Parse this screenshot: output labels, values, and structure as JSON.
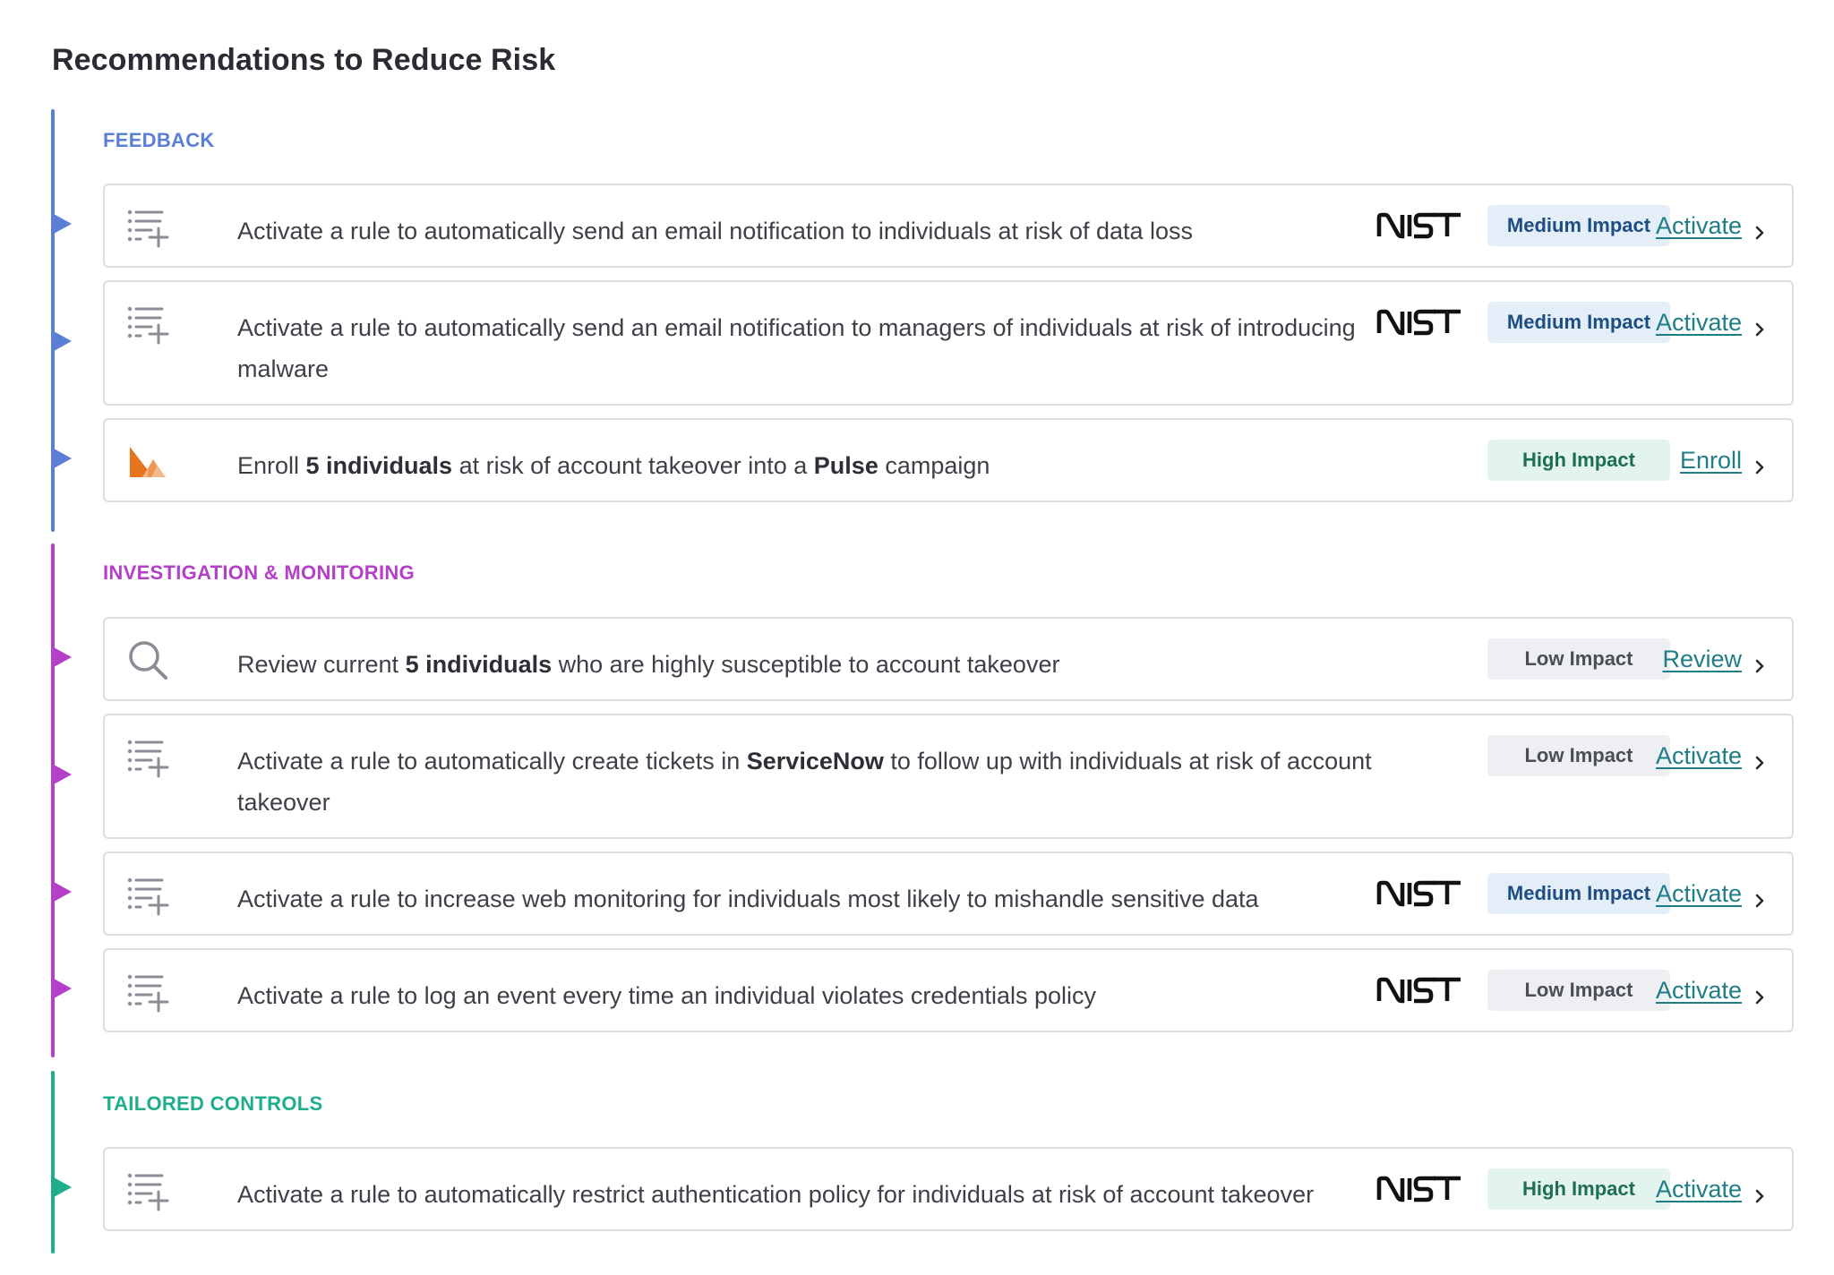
{
  "page": {
    "title": "Recommendations to Reduce Risk"
  },
  "colors": {
    "feedback": "#5b7fd6",
    "investigation": "#b53fc9",
    "tailored": "#1fae8c",
    "link": "#1e7d86"
  },
  "sections": [
    {
      "heading": "FEEDBACK",
      "color": "#5b7fd6",
      "items": [
        {
          "icon": "rule-list-add-icon",
          "text": [
            "Activate a rule to automatically send an email notification to individuals at risk of data loss"
          ],
          "nist": true,
          "nist_label": "NIST",
          "impact": "Medium Impact",
          "action": "Activate"
        },
        {
          "icon": "rule-list-add-icon",
          "text": [
            "Activate a rule to automatically send an email notification to managers of individuals at risk of introducing malware"
          ],
          "nist": true,
          "nist_label": "NIST",
          "impact": "Medium Impact",
          "action": "Activate"
        },
        {
          "icon": "pulse-logo-icon",
          "text": [
            "Enroll ",
            "5 individuals",
            " at risk of account takeover into a ",
            "Pulse",
            " campaign"
          ],
          "nist": false,
          "impact": "High Impact",
          "action": "Enroll"
        }
      ]
    },
    {
      "heading": "INVESTIGATION & MONITORING",
      "color": "#b53fc9",
      "items": [
        {
          "icon": "search-icon",
          "text": [
            "Review current ",
            "5 individuals",
            " who are highly susceptible to account takeover"
          ],
          "nist": false,
          "impact": "Low Impact",
          "action": "Review"
        },
        {
          "icon": "rule-list-add-icon",
          "text": [
            "Activate a rule to automatically create tickets in ",
            "ServiceNow",
            " to follow up with individuals at risk of account takeover"
          ],
          "nist": false,
          "impact": "Low Impact",
          "action": "Activate"
        },
        {
          "icon": "rule-list-add-icon",
          "text": [
            "Activate a rule to increase web monitoring for individuals most likely to mishandle sensitive data"
          ],
          "nist": true,
          "nist_label": "NIST",
          "impact": "Medium Impact",
          "action": "Activate"
        },
        {
          "icon": "rule-list-add-icon",
          "text": [
            "Activate a rule to log an event every time an individual violates credentials policy"
          ],
          "nist": true,
          "nist_label": "NIST",
          "impact": "Low Impact",
          "action": "Activate"
        }
      ]
    },
    {
      "heading": "TAILORED CONTROLS",
      "color": "#1fae8c",
      "items": [
        {
          "icon": "rule-list-add-icon",
          "text": [
            "Activate a rule to automatically restrict authentication policy for individuals at risk of account takeover"
          ],
          "nist": true,
          "nist_label": "NIST",
          "impact": "High Impact",
          "action": "Activate"
        }
      ]
    }
  ]
}
